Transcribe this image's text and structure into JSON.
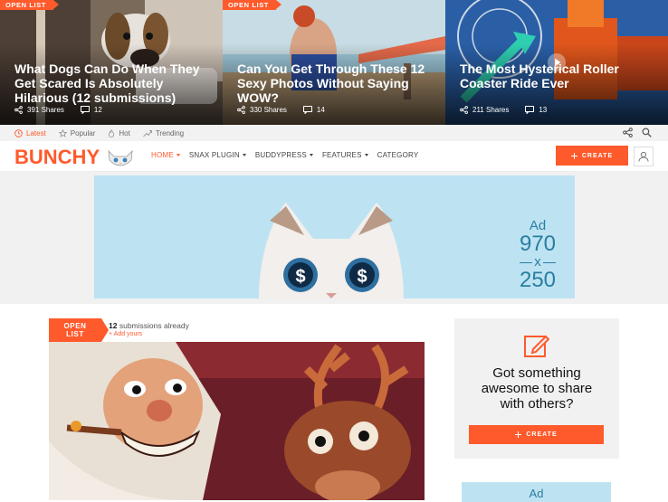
{
  "hero": [
    {
      "badge": "OPEN LIST",
      "title": "What Dogs Can Do When They Get Scared Is Absolutely Hilarious (12 submissions)",
      "shares": "391 Shares",
      "comments": "12"
    },
    {
      "badge": "OPEN LIST",
      "title": "Can You Get Through These 12 Sexy Photos Without Saying WOW?",
      "shares": "330 Shares",
      "comments": "14"
    },
    {
      "badge": "",
      "title": "The Most Hysterical Roller Coaster Ride Ever",
      "shares": "211 Shares",
      "comments": "13"
    }
  ],
  "subnav": {
    "latest": "Latest",
    "popular": "Popular",
    "hot": "Hot",
    "trending": "Trending"
  },
  "brand": {
    "logo": "BUNCHY",
    "accent": "#ff5a2c"
  },
  "menu": {
    "home": "HOME",
    "snax": "SNAX PLUGIN",
    "buddypress": "BUDDYPRESS",
    "features": "FEATURES",
    "category": "CATEGORY"
  },
  "header": {
    "create": "CREATE"
  },
  "ad": {
    "label": "Ad",
    "w": "970",
    "x": "x",
    "h": "250"
  },
  "post": {
    "badge_line1": "OPEN",
    "badge_line2": "LIST",
    "count": "12",
    "submissions": "submissions already",
    "add": "+ Add yours"
  },
  "side": {
    "title": "Got something awesome to share with others?",
    "create": "CREATE",
    "ad_label": "Ad"
  },
  "icons": [
    "share-icon",
    "comment-icon",
    "clock-icon",
    "star-icon",
    "flame-icon",
    "trend-icon",
    "search-icon",
    "user-icon",
    "plus-icon",
    "pencil-icon",
    "play-icon"
  ]
}
